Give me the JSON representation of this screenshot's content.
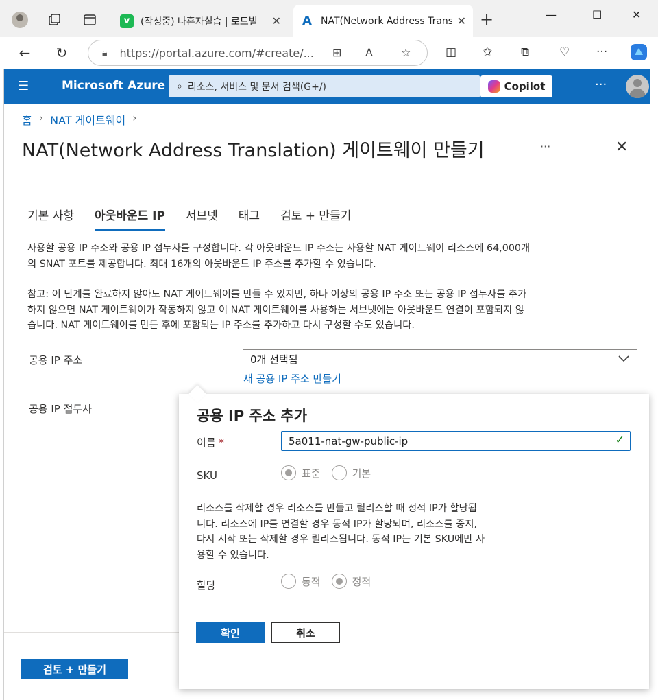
{
  "browser": {
    "tabs": [
      {
        "title": "(작성중) 나혼자실습 | 로드빌",
        "favicon_letter": "v",
        "favicon_color": "#1db954"
      },
      {
        "title": "NAT(Network Address Trans",
        "favicon_letter": "A",
        "favicon_color": "#0f6cbd"
      }
    ],
    "url": "https://portal.azure.com/#create/..."
  },
  "azure_header": {
    "brand": "Microsoft Azure",
    "search_placeholder": "리소스, 서비스 및 문서 검색(G+/)",
    "copilot_label": "Copilot"
  },
  "breadcrumb": [
    "홈",
    "NAT 게이트웨이"
  ],
  "page": {
    "title": "NAT(Network Address Translation) 게이트웨이 만들기",
    "tabs": [
      "기본 사항",
      "아웃바운드 IP",
      "서브넷",
      "태그",
      "검토 + 만들기"
    ],
    "selected_tab": "아웃바운드 IP",
    "intro_lines": [
      "사용할 공용 IP 주소와 공용 IP 접두사를 구성합니다. 각 아웃바운드 IP 주소는 사용할 NAT 게이트웨이 리소스에 64,000개",
      "의 SNAT 포트를 제공합니다. 최대 16개의 아웃바운드 IP 주소를 추가할 수 있습니다."
    ],
    "note_lines": [
      "참고: 이 단계를 완료하지 않아도 NAT 게이트웨이를 만들 수 있지만, 하나 이상의 공용 IP 주소 또는 공용 IP 접두사를 추가",
      "하지 않으면 NAT 게이트웨이가 작동하지 않고 이 NAT 게이트웨이를 사용하는 서브넷에는 아웃바운드 연결이 포함되지 않",
      "습니다. NAT 게이트웨이를 만든 후에 포함되는 IP 주소를 추가하고 다시 구성할 수도 있습니다."
    ],
    "public_ip_label": "공용 IP 주소",
    "public_ip_value": "0개 선택됨",
    "create_public_ip_link": "새 공용 IP 주소 만들기",
    "public_prefix_label": "공용 IP 접두사",
    "review_create_button": "검토 + 만들기"
  },
  "dialog": {
    "title": "공용 IP 주소 추가",
    "name_label": "이름",
    "name_required": "*",
    "name_value": "5a011-nat-gw-public-ip",
    "sku_label": "SKU",
    "sku_options": [
      {
        "label": "표준",
        "selected": true
      },
      {
        "label": "기본",
        "selected": false
      }
    ],
    "description_lines": [
      "리소스를 삭제할 경우 리소스를 만들고 릴리스할 때 정적 IP가 할당됩",
      "니다. 리소스에 IP를 연결할 경우 동적 IP가 할당되며, 리소스를 중지,",
      "다시 시작 또는 삭제할 경우 릴리스됩니다. 동적 IP는 기본 SKU에만 사",
      "용할 수 있습니다."
    ],
    "assignment_label": "할당",
    "assignment_options": [
      {
        "label": "동적",
        "selected": false
      },
      {
        "label": "정적",
        "selected": true
      }
    ],
    "ok_button": "확인",
    "cancel_button": "취소"
  },
  "colors": {
    "azure_blue": "#0f6cbd",
    "required_red": "#a4262c",
    "valid_green": "#107c10"
  }
}
